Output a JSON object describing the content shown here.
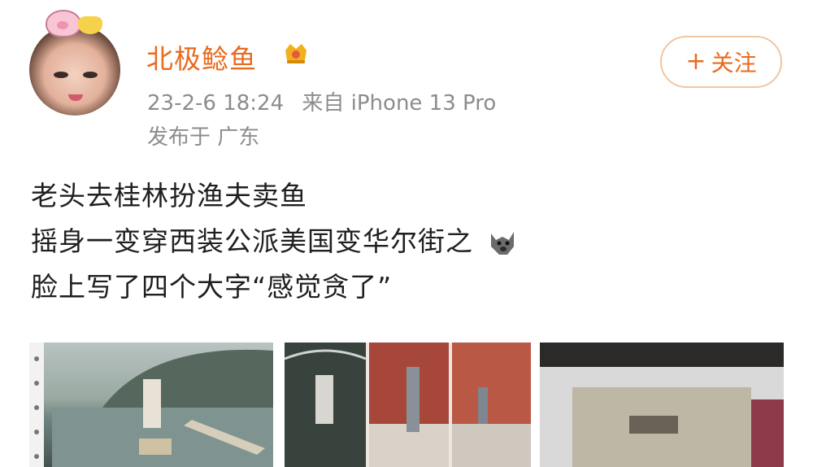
{
  "user": {
    "name": "北极鲶鱼",
    "timestamp": "23-2-6 18:24",
    "source": "来自 iPhone 13 Pro",
    "location": "发布于 广东"
  },
  "follow_button": {
    "plus": "+",
    "label": "关注"
  },
  "post": {
    "lines": [
      "老头去桂林扮渔夫卖鱼",
      "摇身一变穿西装公派美国变华尔街之",
      "脸上写了四个大字“感觉贪了”"
    ],
    "emoji": "doge-icon"
  },
  "colors": {
    "accent": "#e86b1f",
    "meta_text": "#8c8c8c",
    "body_text": "#1f1f1f",
    "follow_border": "#f0c6a3"
  }
}
